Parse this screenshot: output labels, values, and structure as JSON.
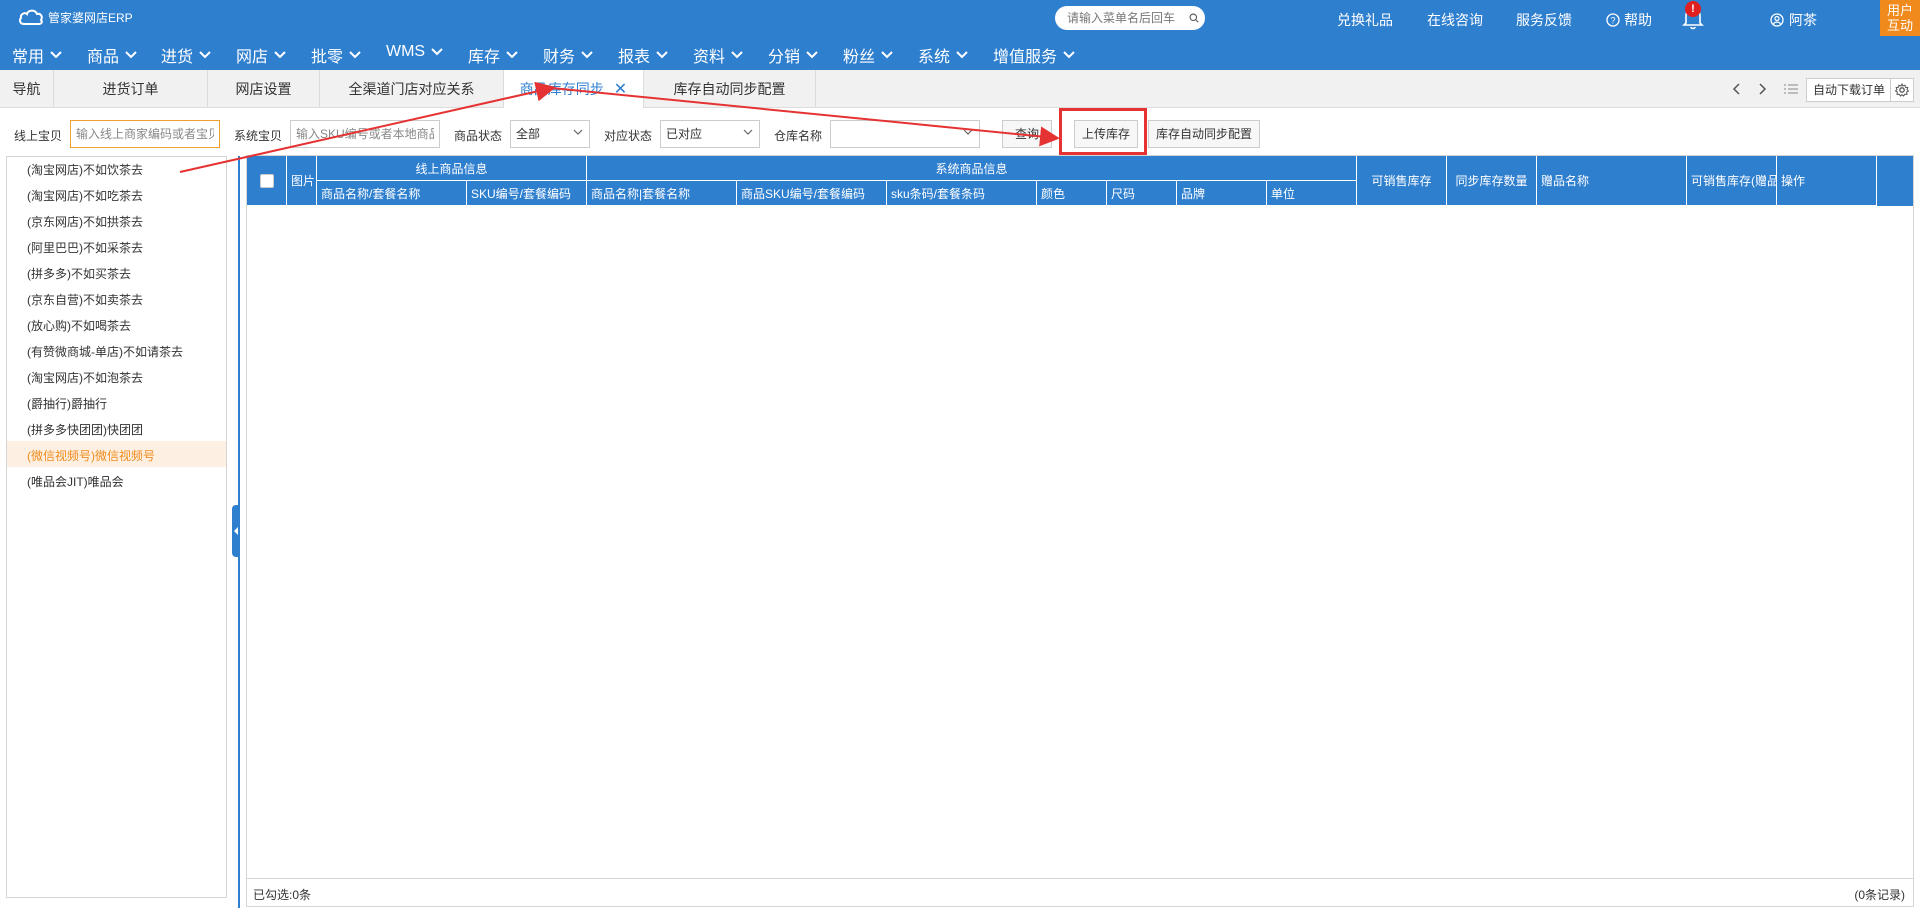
{
  "header": {
    "logo_text": "管家婆网店ERP",
    "search_placeholder": "请输入菜单名后回车",
    "links": [
      "兑换礼品",
      "在线咨询",
      "服务反馈",
      "帮助"
    ],
    "notification_count": "!",
    "user_name": "阿茶",
    "user_interact": [
      "用户",
      "互动"
    ]
  },
  "nav": [
    "常用",
    "商品",
    "进货",
    "网店",
    "批零",
    "WMS",
    "库存",
    "财务",
    "报表",
    "资料",
    "分销",
    "粉丝",
    "系统",
    "增值服务"
  ],
  "tabs": [
    "导航",
    "进货订单",
    "网店设置",
    "全渠道门店对应关系",
    "商品库存同步",
    "库存自动同步配置"
  ],
  "active_tab_index": 4,
  "tab_tools": {
    "auto_download": "自动下载订单"
  },
  "filters": {
    "online_label": "线上宝贝",
    "online_placeholder": "输入线上商家编码或者宝贝",
    "system_label": "系统宝贝",
    "system_placeholder": "输入SKU编号或者本地商品",
    "status_label": "商品状态",
    "status_value": "全部",
    "match_label": "对应状态",
    "match_value": "已对应",
    "warehouse_label": "仓库名称",
    "warehouse_value": "",
    "query_button": "查询",
    "upload_button": "上传库存",
    "auto_config_button": "库存自动同步配置"
  },
  "shops": [
    "(淘宝网店)不如饮茶去",
    "(淘宝网店)不如吃茶去",
    "(京东网店)不如拱茶去",
    "(阿里巴巴)不如采茶去",
    "(拼多多)不如买茶去",
    "(京东自营)不如卖茶去",
    "(放心购)不如喝茶去",
    "(有赞微商城-单店)不如请茶去",
    "(淘宝网店)不如泡茶去",
    "(爵抽行)爵抽行",
    "(拼多多快团团)快团团",
    "(微信视频号)微信视频号",
    "(唯品会JIT)唯品会"
  ],
  "selected_shop_index": 11,
  "grid": {
    "col_image": "图片",
    "group_online": "线上商品信息",
    "group_system": "系统商品信息",
    "online_cols": [
      "商品名称/套餐名称",
      "SKU编号/套餐编码"
    ],
    "system_cols": [
      "商品名称|套餐名称",
      "商品SKU编号/套餐编码",
      "sku条码/套餐条码",
      "颜色",
      "尺码",
      "品牌",
      "单位"
    ],
    "tail_cols": [
      "可销售库存",
      "同步库存数量",
      "赠品名称",
      "可销售库存(赠品)",
      "操作"
    ],
    "footer_selected": "已勾选:0条",
    "footer_records": "(0条记录)"
  },
  "colors": {
    "brand_blue": "#2f7fcf",
    "accent_orange": "#f08a1c",
    "annotation_red": "#e53232"
  }
}
